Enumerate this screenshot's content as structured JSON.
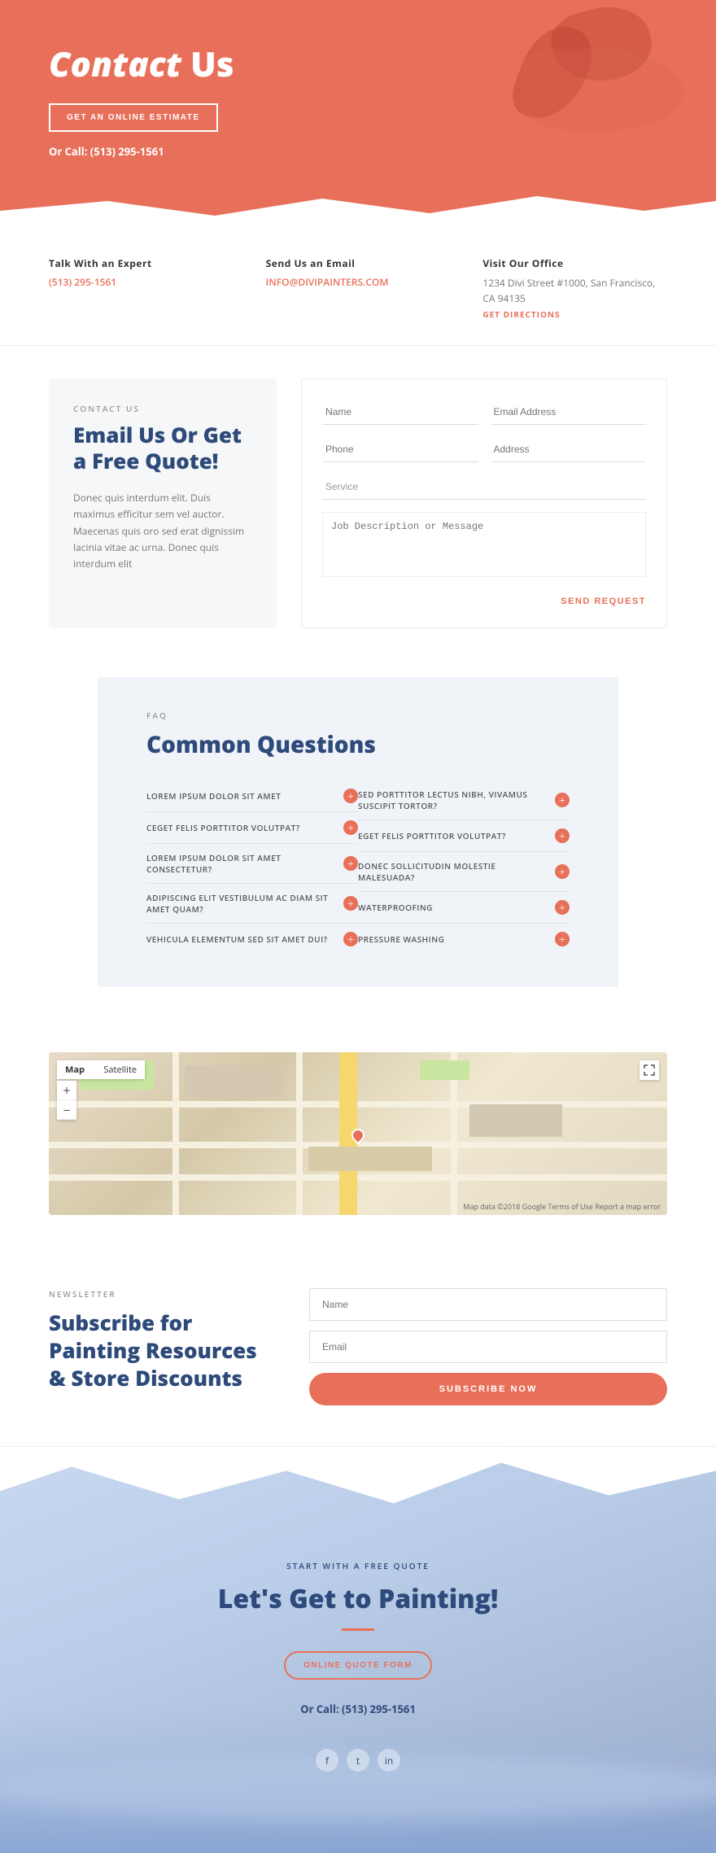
{
  "hero": {
    "title_bold": "Contact",
    "title_light": " Us",
    "btn_label": "GET AN ONLINE ESTIMATE",
    "call_prefix": "Or Call:",
    "phone": "(513) 295-1561"
  },
  "info_bar": {
    "items": [
      {
        "heading": "Talk With an Expert",
        "phone": "(513) 295-1561",
        "extra": null
      },
      {
        "heading": "Send Us an Email",
        "email": "INFO@DIVIPAINTERS.COM",
        "extra": null
      },
      {
        "heading": "Visit Our Office",
        "address": "1234 Divi Street #1000, San Francisco, CA 94135",
        "directions": "GET DIRECTIONS"
      }
    ]
  },
  "contact_form": {
    "section_label": "CONTACT US",
    "heading": "Email Us Or Get a Free Quote!",
    "description": "Donec quis interdum elit. Duis maximus efficitur sem vel auctor. Maecenas quis oro sed erat dignissim lacinia vitae ac urna. Donec quis interdum elit",
    "fields": {
      "name_placeholder": "Name",
      "email_placeholder": "Email Address",
      "phone_placeholder": "Phone",
      "address_placeholder": "Address",
      "service_placeholder": "Service",
      "message_placeholder": "Job Description or Message"
    },
    "submit_label": "SEND REQUEST"
  },
  "faq": {
    "section_label": "FAQ",
    "heading": "Common Questions",
    "items_left": [
      "LOREM IPSUM DOLOR SIT AMET",
      "CEGET FELIS PORTTITOR VOLUTPAT?",
      "LOREM IPSUM DOLOR SIT AMET CONSECTETUR?",
      "ADIPISCING ELIT VESTIBULUM AC DIAM SIT AMET QUAM?",
      "VEHICULA ELEMENTUM SED SIT AMET DUI?"
    ],
    "items_right": [
      "SED PORTTITOR LECTUS NIBH, VIVAMUS SUSCIPIT TORTOR?",
      "EGET FELIS PORTTITOR VOLUTPAT?",
      "DONEC SOLLICITUDIN MOLESTIE MALESUADA?",
      "WATERPROOFING",
      "PRESSURE WASHING"
    ]
  },
  "map": {
    "tab_map": "Map",
    "tab_satellite": "Satellite",
    "footer_text": "Map data ©2018 Google   Terms of Use   Report a map error"
  },
  "newsletter": {
    "section_label": "NEWSLETTER",
    "heading": "Subscribe for Painting Resources & Store Discounts",
    "name_placeholder": "Name",
    "email_placeholder": "Email",
    "btn_label": "SUBSCRIBE NOW"
  },
  "footer_cta": {
    "sublabel": "START WITH A FREE QUOTE",
    "heading": "Let's Get to Painting!",
    "btn_label": "ONLINE QUOTE FORM",
    "call_prefix": "Or Call:",
    "phone": "(513) 295-1561",
    "social": [
      "f",
      "t",
      "in"
    ]
  }
}
